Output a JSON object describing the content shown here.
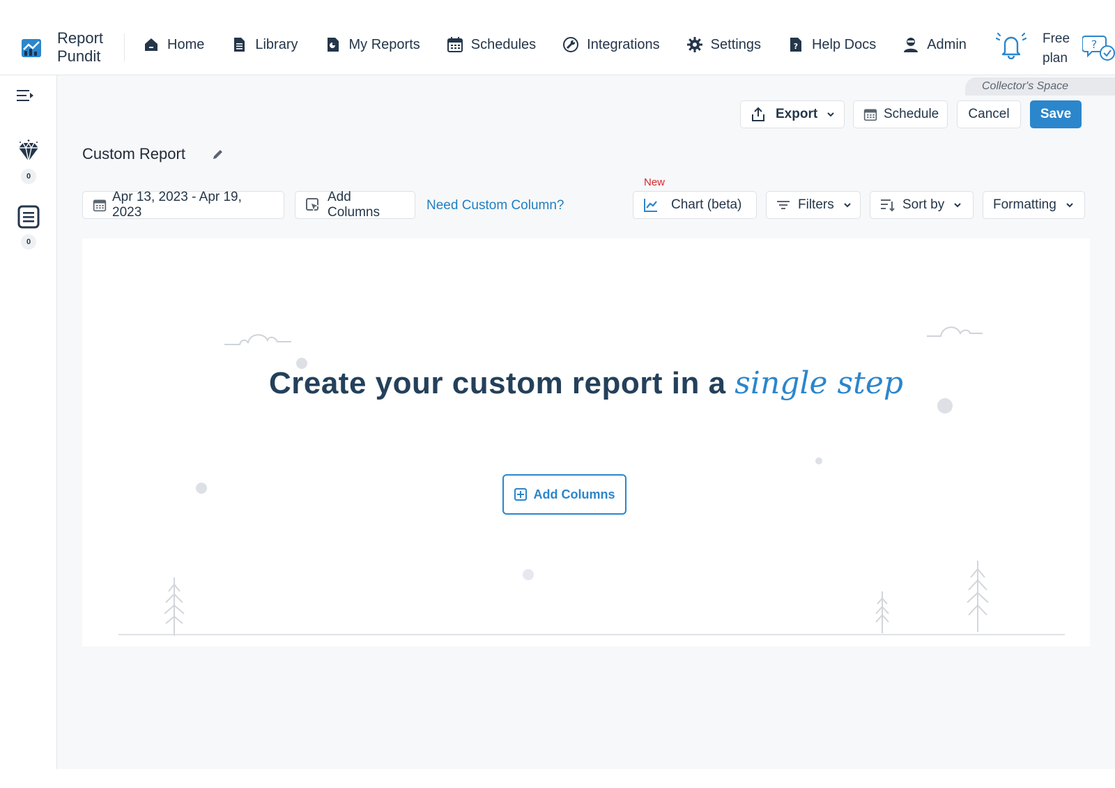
{
  "app": {
    "name": "Report\nPundit",
    "brand_color": "#2b86cc"
  },
  "nav": {
    "items": [
      {
        "label": "Home",
        "icon": "home-icon"
      },
      {
        "label": "Library",
        "icon": "library-icon"
      },
      {
        "label": "My Reports",
        "icon": "my-reports-icon"
      },
      {
        "label": "Schedules",
        "icon": "calendar-icon"
      },
      {
        "label": "Integrations",
        "icon": "wrench-icon"
      },
      {
        "label": "Settings",
        "icon": "gear-icon"
      },
      {
        "label": "Help Docs",
        "icon": "help-doc-icon"
      },
      {
        "label": "Admin",
        "icon": "admin-icon"
      }
    ],
    "plan": "Free\nplan"
  },
  "sidebar": {
    "diamond_count": "0",
    "list_count": "0"
  },
  "workspace": {
    "space_label": "Collector's Space"
  },
  "toolbar": {
    "export_label": "Export",
    "schedule_label": "Schedule",
    "cancel_label": "Cancel",
    "save_label": "Save"
  },
  "report": {
    "title": "Custom Report",
    "date_range": "Apr 13, 2023 - Apr 19, 2023",
    "add_columns_label": "Add Columns",
    "custom_column_link": "Need Custom Column?",
    "new_badge": "New",
    "chart_label": "Chart (beta)",
    "filters_label": "Filters",
    "sort_label": "Sort by",
    "formatting_label": "Formatting"
  },
  "empty_state": {
    "headline": "Create your custom report in a ",
    "headline_accent": "single step",
    "cta_label": "Add Columns"
  }
}
